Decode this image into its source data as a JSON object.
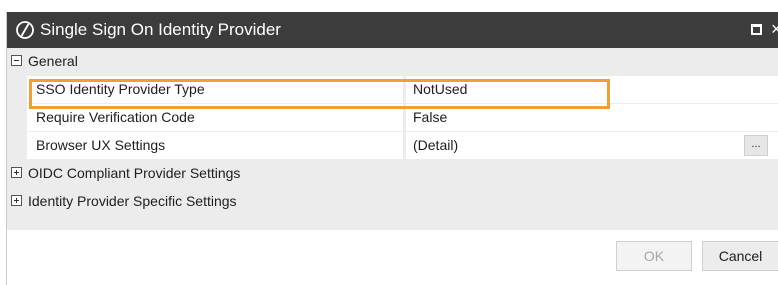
{
  "window": {
    "title": "Single Sign On Identity Provider",
    "icon": "circle-slash-icon",
    "maximize_icon": "maximize-icon",
    "close_glyph": "×"
  },
  "grid": {
    "categories": [
      {
        "label": "General",
        "expanded": true,
        "properties": [
          {
            "name": "SSO Identity Provider Type",
            "value": "NotUsed",
            "highlighted": true
          },
          {
            "name": "Require Verification Code",
            "value": "False"
          },
          {
            "name": "Browser UX Settings",
            "value": "(Detail)",
            "ellipsis": "..."
          }
        ]
      },
      {
        "label": "OIDC Compliant Provider Settings",
        "expanded": false
      },
      {
        "label": "Identity Provider Specific Settings",
        "expanded": false
      }
    ]
  },
  "buttons": {
    "ok": "OK",
    "cancel": "Cancel"
  },
  "colors": {
    "titlebar": "#3c3c3c",
    "highlight": "#f0a030",
    "grid_background": "#ececec"
  }
}
